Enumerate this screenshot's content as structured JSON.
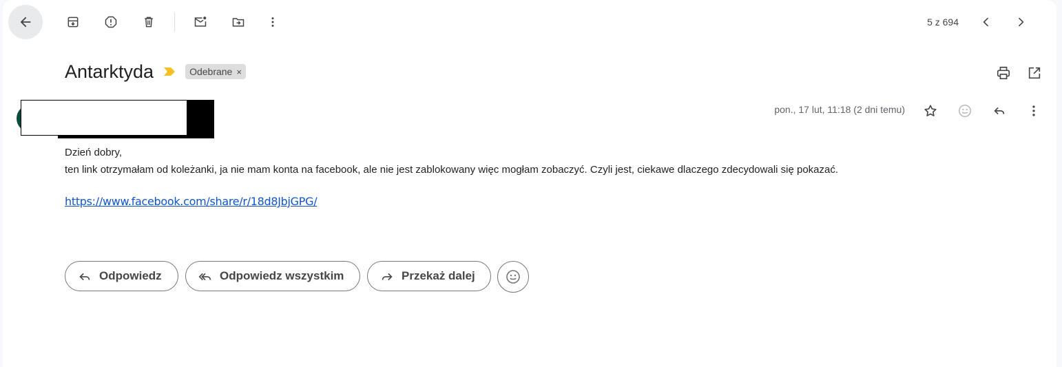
{
  "toolbar": {
    "back_icon": "arrow-back-icon",
    "archive_icon": "archive-icon",
    "spam_icon": "report-spam-icon",
    "delete_icon": "trash-icon",
    "mark_unread_icon": "mark-unread-icon",
    "move_icon": "move-to-icon",
    "more_icon": "more-vert-icon",
    "pager_text": "5 z 694",
    "prev_icon": "chevron-left-icon",
    "next_icon": "chevron-right-icon"
  },
  "thread": {
    "subject": "Antarktyda",
    "importance_color": "#f6bf26",
    "label": "Odebrane",
    "label_remove": "×",
    "print_icon": "print-icon",
    "new_window_icon": "open-new-window-icon"
  },
  "message": {
    "timestamp": "pon., 17 lut, 11:18 (2 dni temu)",
    "star_icon": "star-icon",
    "emoji_icon": "emoji-icon",
    "reply_icon": "reply-icon",
    "more_icon": "more-vert-icon",
    "avatar_color": "#0b4a3e",
    "body_lines": [
      "Dzień dobry,",
      "ten link otrzymałam od koleżanki, ja nie mam konta na facebook, ale nie jest zablokowany więc mogłam zobaczyć. Czyli jest, ciekawe dlaczego zdecydowali się pokazać."
    ],
    "link": "https://www.facebook.com/share/r/18d8JbjGPG/"
  },
  "actions": {
    "reply_label": "Odpowiedz",
    "reply_all_label": "Odpowiedz wszystkim",
    "forward_label": "Przekaż dalej",
    "emoji_icon": "emoji-reaction-icon"
  }
}
